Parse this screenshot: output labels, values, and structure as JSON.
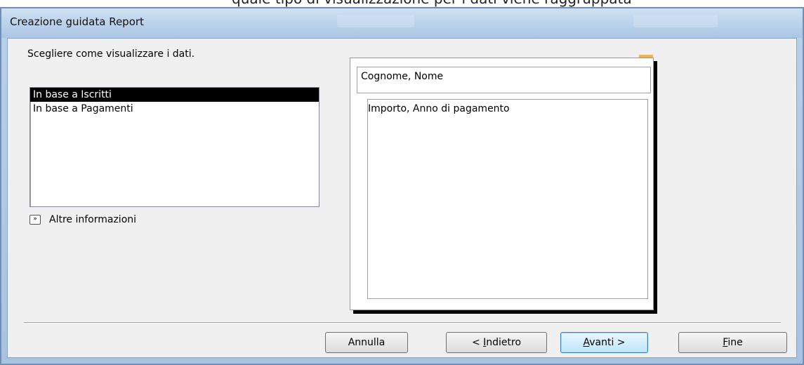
{
  "window": {
    "title": "Creazione guidata Report",
    "caption_partial": "quale tipo di visualizzazione per i dati viene raggruppata"
  },
  "prompt": "Scegliere come visualizzare i dati.",
  "view_options": [
    {
      "label": "In base a Iscritti",
      "selected": true
    },
    {
      "label": "In base a Pagamenti",
      "selected": false
    }
  ],
  "more_info": {
    "label": "Altre informazioni",
    "icon": "double-chevron-right-icon"
  },
  "preview": {
    "group_header": "Cognome, Nome",
    "detail": "Importo, Anno di pagamento"
  },
  "buttons": {
    "cancel": "Annulla",
    "back_prefix": "< ",
    "back_mnemonic": "I",
    "back_rest": "ndietro",
    "next_mnemonic": "A",
    "next_rest": "vanti >",
    "finish_mnemonic": "F",
    "finish_rest": "ine"
  },
  "colors": {
    "selection": "#000000",
    "title_bar": "#bcd3ec",
    "dialog_face": "#f0f0f0",
    "default_button": "#bee6fd",
    "preview_corner_accent": "#e98b1a"
  }
}
